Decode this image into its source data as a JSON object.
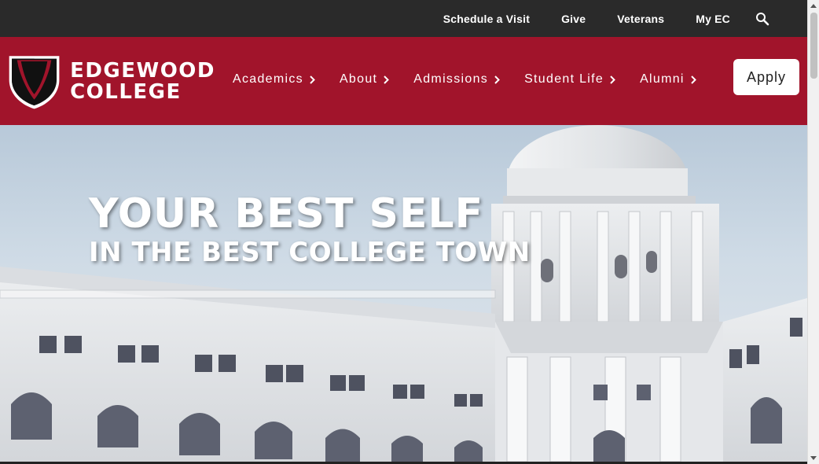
{
  "topbar": {
    "links": [
      "Schedule a Visit",
      "Give",
      "Veterans",
      "My EC"
    ],
    "search_icon": "search-icon"
  },
  "logo": {
    "line1": "EDGEWOOD",
    "line2": "COLLEGE"
  },
  "nav": {
    "items": [
      "Academics",
      "About",
      "Admissions",
      "Student Life",
      "Alumni"
    ],
    "apply_label": "Apply"
  },
  "hero": {
    "line1": "YOUR BEST SELF",
    "line2": "IN THE BEST COLLEGE TOWN"
  },
  "colors": {
    "brand_red": "#a1142b",
    "topbar": "#2a2a2a"
  }
}
